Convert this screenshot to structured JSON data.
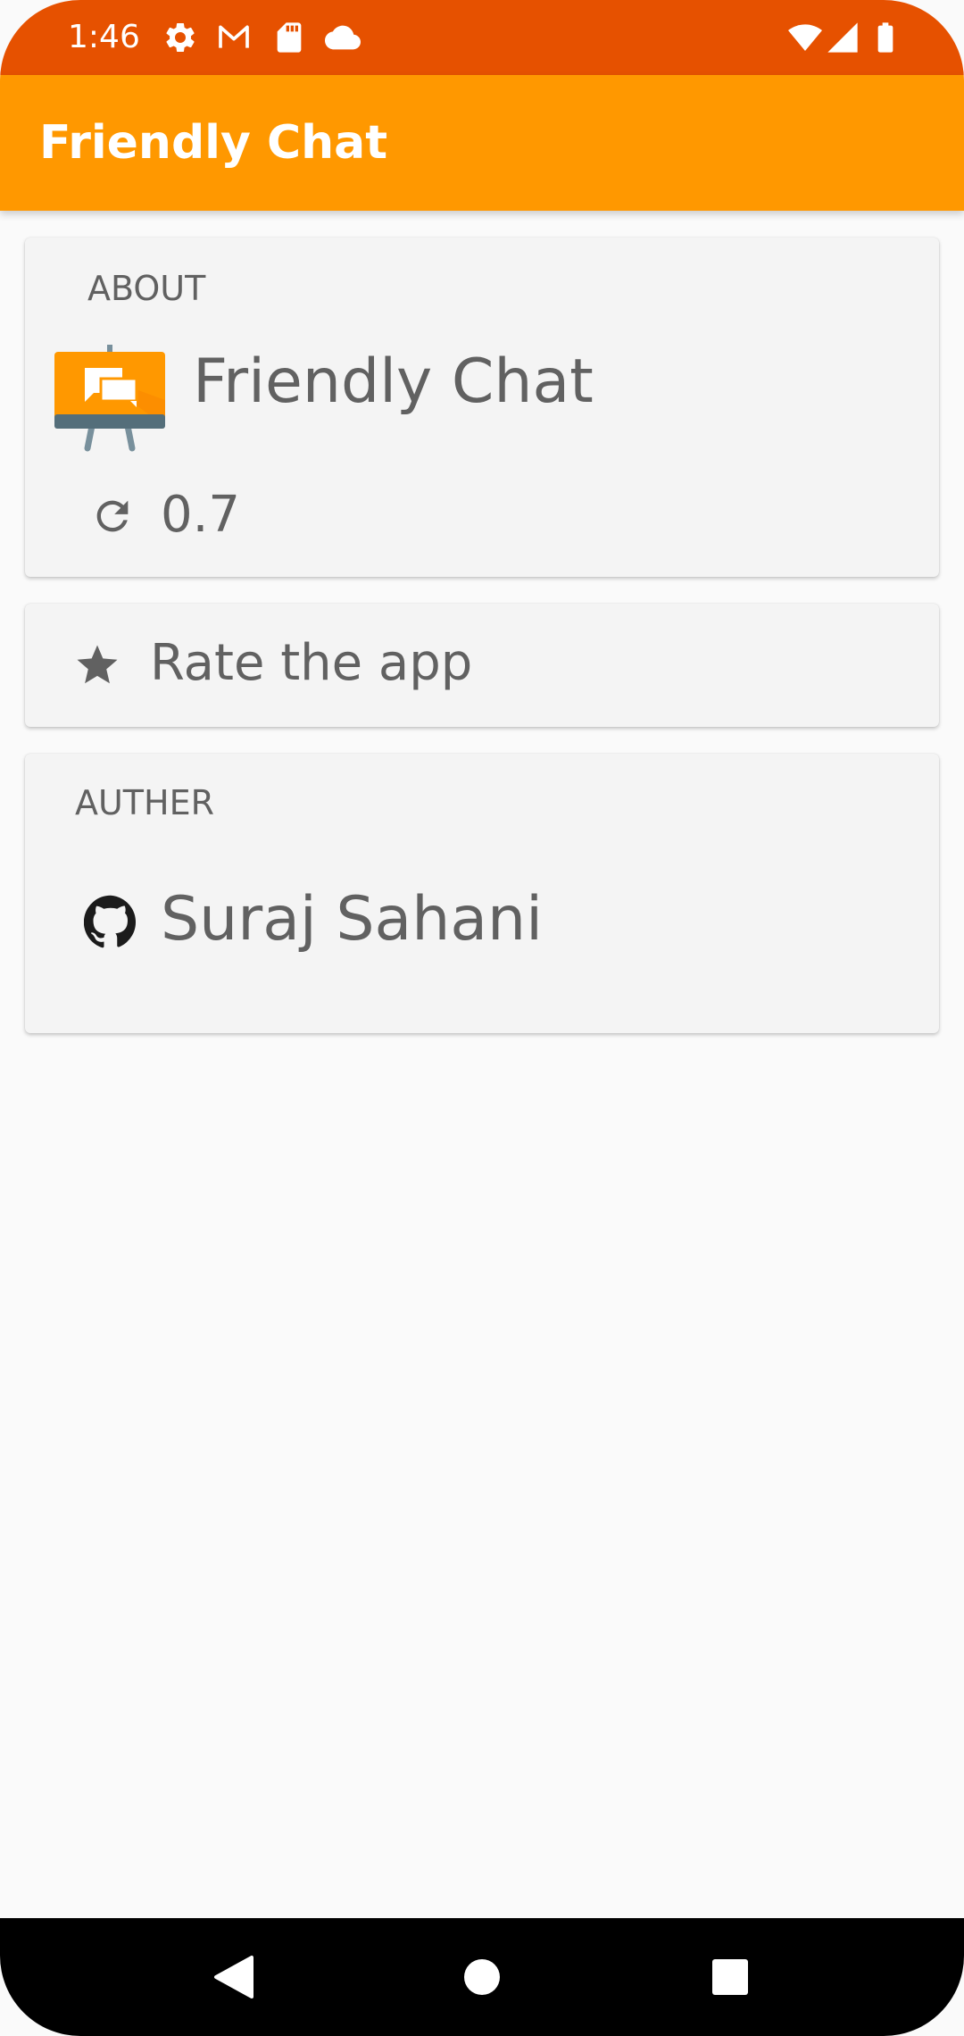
{
  "status_bar": {
    "time": "1:46",
    "color": "#e65100",
    "left_icons": [
      "settings-icon",
      "gmail-icon",
      "sd-card-icon",
      "cloud-icon"
    ],
    "right_icons": [
      "wifi-icon",
      "signal-icon",
      "battery-icon"
    ]
  },
  "app_bar": {
    "title": "Friendly Chat",
    "color": "#ff9800"
  },
  "about": {
    "section_label": "ABOUT",
    "app_name": "Friendly Chat",
    "version": "0.7"
  },
  "rate": {
    "label": "Rate the app"
  },
  "author": {
    "section_label": "AUTHER",
    "name": "Suraj Sahani"
  },
  "nav_bar": {
    "buttons": [
      "back-icon",
      "home-icon",
      "recents-icon"
    ]
  }
}
